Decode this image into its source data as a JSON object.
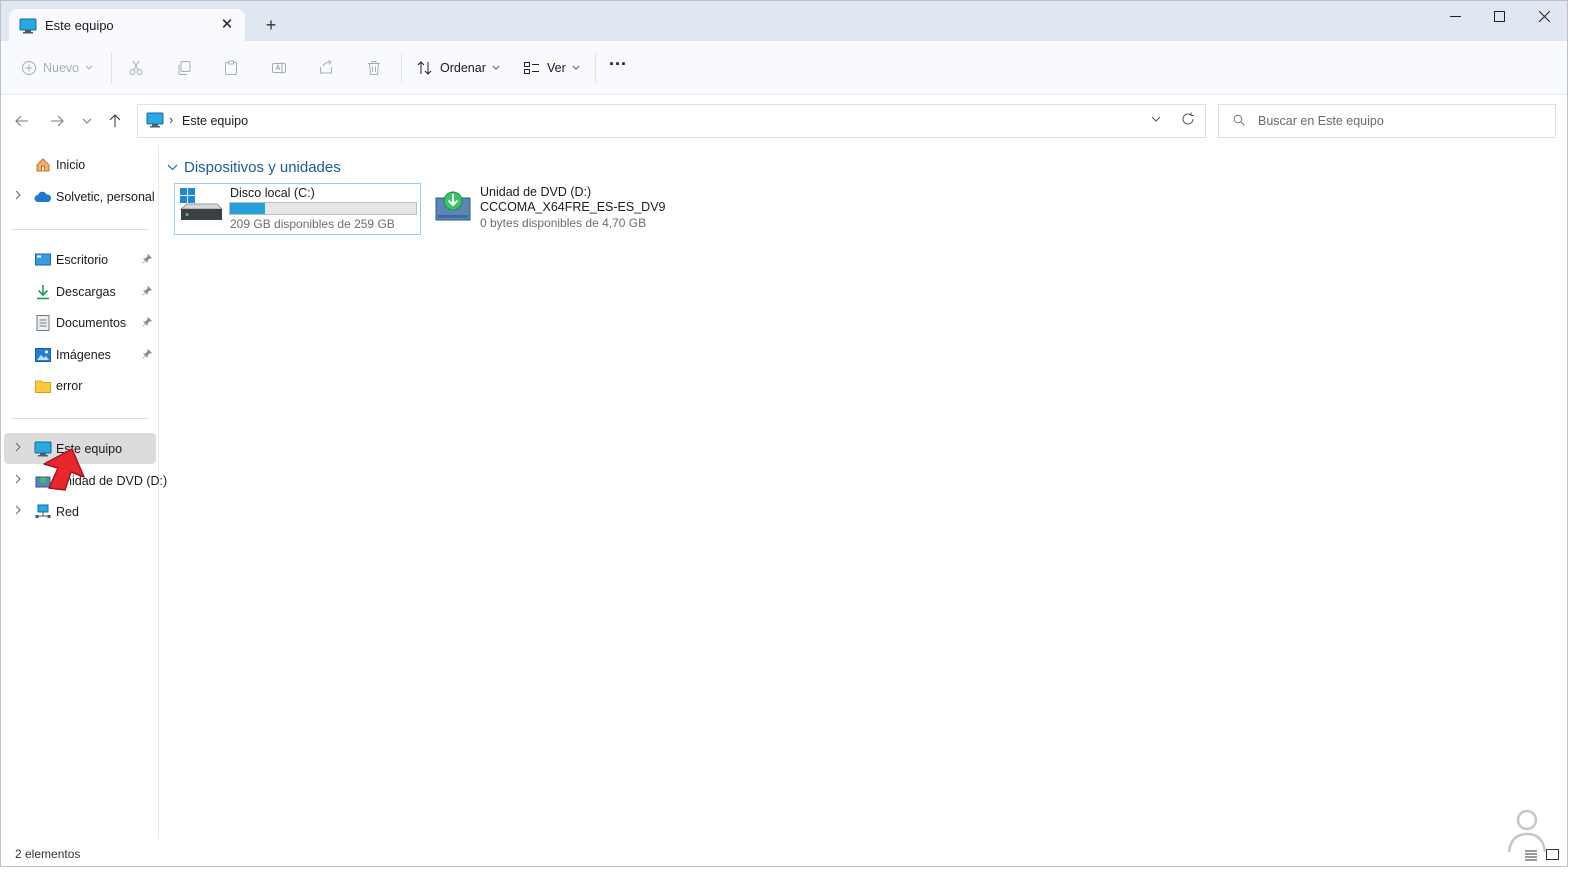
{
  "tab": {
    "title": "Este equipo",
    "close": "✕",
    "new_tab": "+"
  },
  "toolbar": {
    "new_label": "Nuevo",
    "sort_label": "Ordenar",
    "view_label": "Ver",
    "more": "···"
  },
  "address": {
    "crumb": "Este equipo",
    "separator": "›"
  },
  "search": {
    "placeholder": "Buscar en Este equipo"
  },
  "sidebar": {
    "home": "Inicio",
    "onedrive": "Solvetic, personal",
    "quick": [
      {
        "label": "Escritorio",
        "icon": "desktop-icon",
        "pinned": true
      },
      {
        "label": "Descargas",
        "icon": "download-icon",
        "pinned": true
      },
      {
        "label": "Documentos",
        "icon": "document-icon",
        "pinned": true
      },
      {
        "label": "Imágenes",
        "icon": "pictures-icon",
        "pinned": true
      },
      {
        "label": "error",
        "icon": "folder-icon",
        "pinned": false
      }
    ],
    "this_pc": "Este equipo",
    "dvd": "Unidad de DVD (D:)",
    "network": "Red"
  },
  "content": {
    "group_title": "Dispositivos y unidades",
    "drives": [
      {
        "name": "Disco local (C:)",
        "free": "209 GB disponibles de 259 GB",
        "used_fraction": 0.19
      },
      {
        "name": "Unidad de DVD (D:)",
        "volume": "CCCOMA_X64FRE_ES-ES_DV9",
        "free": "0 bytes disponibles de 4,70 GB"
      }
    ]
  },
  "status": {
    "count": "2 elementos"
  },
  "colors": {
    "accent": "#26a0da",
    "group_header": "#1a5a9e",
    "titlebar": "#dfe7f1",
    "arrow": "#e8262d"
  }
}
